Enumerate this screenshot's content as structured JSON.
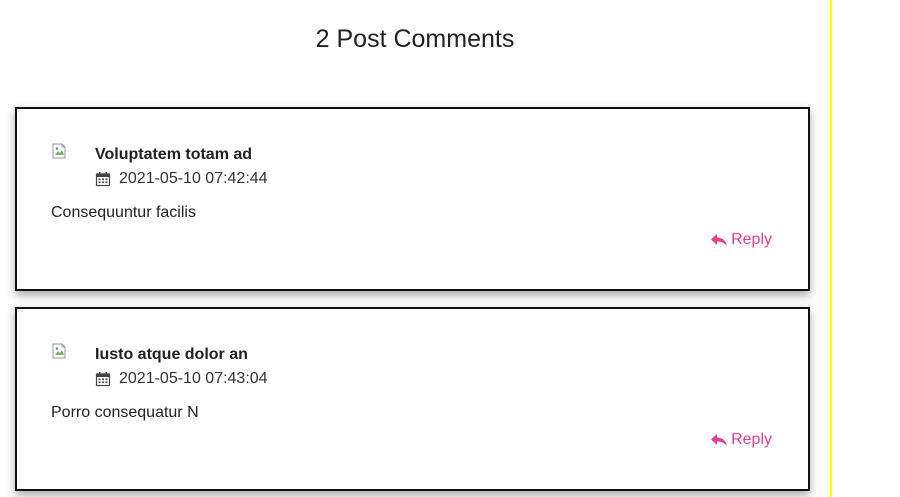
{
  "comments_section": {
    "title": "2 Post Comments"
  },
  "comments": [
    {
      "author": "Voluptatem totam ad",
      "date": "2021-05-10 07:42:44",
      "body": "Consequuntur facilis",
      "reply_label": "Reply"
    },
    {
      "author": "Iusto atque dolor an",
      "date": "2021-05-10 07:43:04",
      "body": "Porro consequatur N",
      "reply_label": "Reply"
    }
  ],
  "colors": {
    "accent": "#e83e8c",
    "side_rule": "#ffff00",
    "card_border": "#111111"
  },
  "icons": {
    "avatar": "broken-image-icon",
    "date": "calendar-icon",
    "reply": "reply-arrow-icon"
  }
}
